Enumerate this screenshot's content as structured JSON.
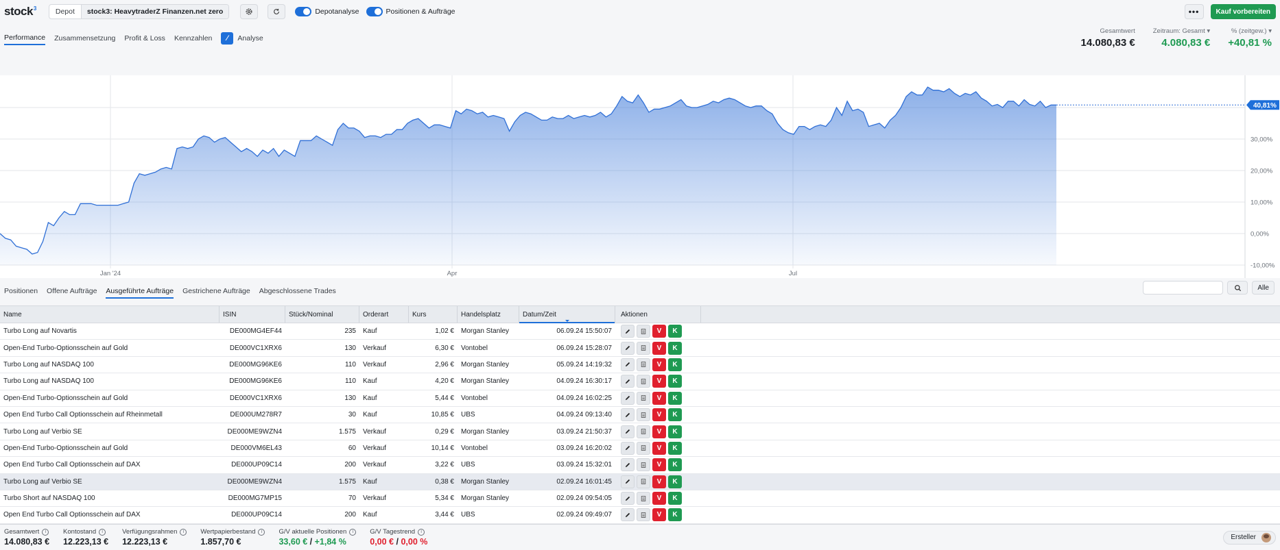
{
  "logo": {
    "text": "stock",
    "sup": "3"
  },
  "depot": {
    "label": "Depot",
    "value": "stock3: HeavytraderZ Finanzen.net zero"
  },
  "toggles": [
    {
      "label": "Depotanalyse",
      "on": true
    },
    {
      "label": "Positionen & Aufträge",
      "on": true
    }
  ],
  "topbar": {
    "more_label": "•••",
    "buy_label": "Kauf vorbereiten"
  },
  "navtabs": [
    {
      "label": "Performance",
      "active": true
    },
    {
      "label": "Zusammensetzung",
      "active": false
    },
    {
      "label": "Profit & Loss",
      "active": false
    },
    {
      "label": "Kennzahlen",
      "active": false
    },
    {
      "label": "Analyse",
      "active": false
    }
  ],
  "summary": {
    "gesamtwert_label": "Gesamtwert",
    "gesamtwert": "14.080,83 €",
    "zeitraum_label": "Zeitraum: Gesamt ▾",
    "zeitraum_value": "4.080,83 €",
    "pct_label": "% (zeitgew.) ▾",
    "pct_value": "+40,81 %"
  },
  "chart_data": {
    "type": "area",
    "x_ticks": [
      "Jan '24",
      "Apr",
      "Jul"
    ],
    "y_ticks": [
      "30,00%",
      "20,00%",
      "10,00%",
      "0,00%",
      "-10,00%"
    ],
    "y_tick_values": [
      30,
      20,
      10,
      0,
      -10
    ],
    "current_label": "40,81%",
    "current_value": 40.81,
    "ylim": [
      -10,
      50
    ],
    "color": "#2f6fd6",
    "values": [
      0.0,
      -1.5,
      -2.0,
      -4.0,
      -4.5,
      -5.0,
      -6.5,
      -6.0,
      -2.5,
      3.5,
      2.5,
      5.0,
      7.0,
      6.0,
      6.0,
      9.5,
      9.5,
      9.5,
      9.0,
      9.0,
      9.0,
      9.0,
      9.0,
      9.5,
      10.0,
      16.0,
      19.0,
      18.5,
      19.0,
      19.5,
      20.5,
      21.0,
      20.5,
      27.0,
      27.5,
      27.0,
      27.5,
      30.0,
      31.0,
      30.5,
      29.0,
      30.0,
      30.5,
      29.0,
      27.5,
      26.0,
      27.0,
      26.0,
      24.5,
      26.5,
      25.5,
      27.0,
      24.5,
      26.5,
      25.5,
      24.5,
      29.5,
      29.5,
      29.5,
      31.0,
      30.0,
      29.0,
      28.0,
      33.0,
      35.0,
      33.5,
      33.5,
      32.5,
      30.5,
      31.0,
      31.0,
      30.5,
      31.5,
      31.5,
      33.0,
      33.0,
      35.0,
      36.0,
      36.5,
      35.0,
      33.5,
      34.5,
      34.5,
      34.0,
      33.5,
      39.0,
      38.0,
      39.5,
      39.0,
      38.0,
      38.5,
      37.0,
      37.5,
      37.0,
      36.5,
      32.5,
      35.5,
      37.5,
      38.5,
      38.0,
      37.0,
      36.0,
      36.0,
      37.0,
      36.5,
      36.5,
      37.5,
      36.5,
      37.0,
      37.5,
      37.0,
      37.5,
      38.5,
      37.0,
      38.0,
      40.5,
      43.5,
      42.0,
      41.5,
      44.0,
      41.5,
      38.5,
      39.5,
      39.5,
      40.0,
      40.5,
      41.5,
      42.5,
      40.5,
      40.0,
      40.0,
      40.5,
      41.0,
      42.0,
      41.5,
      42.5,
      43.0,
      42.5,
      41.5,
      40.5,
      40.0,
      40.5,
      40.5,
      39.0,
      38.0,
      35.0,
      33.0,
      32.0,
      31.5,
      34.0,
      34.0,
      33.0,
      34.0,
      34.5,
      34.0,
      36.0,
      40.0,
      37.5,
      42.0,
      39.0,
      39.5,
      38.5,
      34.0,
      34.5,
      35.0,
      33.5,
      36.0,
      37.5,
      40.0,
      43.5,
      45.0,
      44.0,
      44.0,
      46.5,
      45.5,
      45.5,
      45.0,
      46.0,
      44.5,
      43.5,
      44.5,
      44.0,
      45.0,
      43.0,
      42.0,
      40.5,
      41.0,
      40.0,
      42.0,
      42.0,
      40.5,
      42.5,
      41.0,
      40.5,
      42.0,
      40.0,
      40.81,
      40.81
    ]
  },
  "ordertabs": [
    {
      "label": "Positionen",
      "active": false
    },
    {
      "label": "Offene Aufträge",
      "active": false
    },
    {
      "label": "Ausgeführte Aufträge",
      "active": true
    },
    {
      "label": "Gestrichene Aufträge",
      "active": false
    },
    {
      "label": "Abgeschlossene Trades",
      "active": false
    }
  ],
  "search": {
    "placeholder": "",
    "all_label": "Alle"
  },
  "table": {
    "headers": [
      "Name",
      "ISIN",
      "Stück/Nominal",
      "Orderart",
      "Kurs",
      "Handelsplatz",
      "Datum/Zeit",
      "Aktionen"
    ],
    "action_labels": {
      "sell": "V",
      "buy": "K"
    },
    "rows": [
      [
        "Turbo Long auf Novartis",
        "DE000MG4EF44",
        "235",
        "Kauf",
        "1,02 €",
        "Morgan Stanley",
        "06.09.24 15:50:07"
      ],
      [
        "Open-End Turbo-Optionsschein auf Gold",
        "DE000VC1XRX6",
        "130",
        "Verkauf",
        "6,30 €",
        "Vontobel",
        "06.09.24 15:28:07"
      ],
      [
        "Turbo Long auf NASDAQ 100",
        "DE000MG96KE6",
        "110",
        "Verkauf",
        "2,96 €",
        "Morgan Stanley",
        "05.09.24 14:19:32"
      ],
      [
        "Turbo Long auf NASDAQ 100",
        "DE000MG96KE6",
        "110",
        "Kauf",
        "4,20 €",
        "Morgan Stanley",
        "04.09.24 16:30:17"
      ],
      [
        "Open-End Turbo-Optionsschein auf Gold",
        "DE000VC1XRX6",
        "130",
        "Kauf",
        "5,44 €",
        "Vontobel",
        "04.09.24 16:02:25"
      ],
      [
        "Open End Turbo Call Optionsschein auf Rheinmetall",
        "DE000UM278R7",
        "30",
        "Kauf",
        "10,85 €",
        "UBS",
        "04.09.24 09:13:40"
      ],
      [
        "Turbo Long auf Verbio SE",
        "DE000ME9WZN4",
        "1.575",
        "Verkauf",
        "0,29 €",
        "Morgan Stanley",
        "03.09.24 21:50:37"
      ],
      [
        "Open-End Turbo-Optionsschein auf Gold",
        "DE000VM6EL43",
        "60",
        "Verkauf",
        "10,14 €",
        "Vontobel",
        "03.09.24 16:20:02"
      ],
      [
        "Open End Turbo Call Optionsschein auf DAX",
        "DE000UP09C14",
        "200",
        "Verkauf",
        "3,22 €",
        "UBS",
        "03.09.24 15:32:01"
      ],
      [
        "Turbo Long auf Verbio SE",
        "DE000ME9WZN4",
        "1.575",
        "Kauf",
        "0,38 €",
        "Morgan Stanley",
        "02.09.24 16:01:45"
      ],
      [
        "Turbo Short auf NASDAQ 100",
        "DE000MG7MP15",
        "70",
        "Verkauf",
        "5,34 €",
        "Morgan Stanley",
        "02.09.24 09:54:05"
      ],
      [
        "Open End Turbo Call Optionsschein auf DAX",
        "DE000UP09C14",
        "200",
        "Kauf",
        "3,44 €",
        "UBS",
        "02.09.24 09:49:07"
      ]
    ]
  },
  "footer": {
    "items": [
      {
        "label": "Gesamtwert",
        "value": "14.080,83 €"
      },
      {
        "label": "Kontostand",
        "value": "12.223,13 €"
      },
      {
        "label": "Verfügungsrahmen",
        "value": "12.223,13 €"
      },
      {
        "label": "Wertpapierbestand",
        "value": "1.857,70 €"
      }
    ],
    "gv_positions": {
      "label": "G/V aktuelle Positionen",
      "abs": "33,60 €",
      "sep": " / ",
      "pct": "+1,84 %"
    },
    "gv_day": {
      "label": "G/V Tagestrend",
      "abs": "0,00 €",
      "sep": " / ",
      "pct": "0,00 %"
    },
    "creator_label": "Ersteller"
  },
  "colors": {
    "accent": "#1e6fd9",
    "positive": "#1f9a52",
    "negative": "#e0202e"
  }
}
